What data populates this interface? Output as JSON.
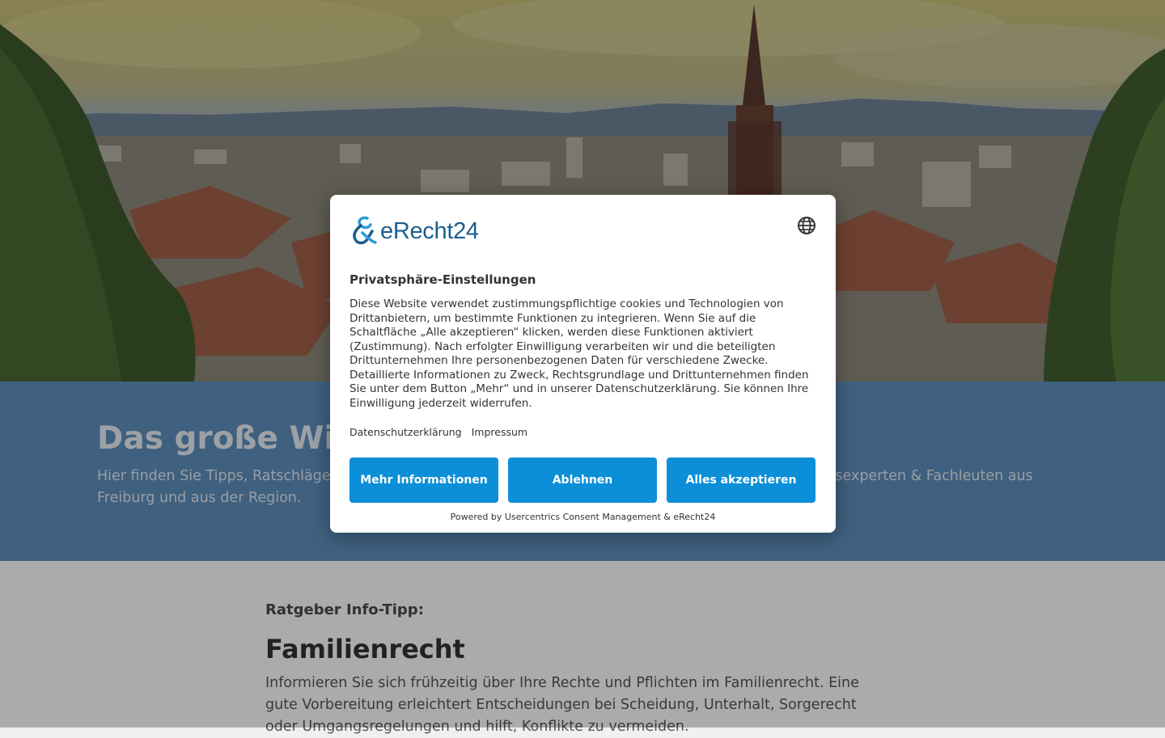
{
  "page": {
    "hero_image": "Freiburg city panorama with Freiburg Minster cathedral spire",
    "headline": "Das große Wissensportal für Recht & Rat",
    "intro": "Hier finden Sie Tipps, Ratschläge und Wissenswertes rund um Recht und Gesetz – aufbereitet von Rechtsexperten & Fachleuten aus Freiburg und aus der Region.",
    "tip_label": "Ratgeber Info-Tipp:",
    "tip_title": "Familienrecht",
    "tip_text": "Informieren Sie sich frühzeitig über Ihre Rechte und Pflichten im Familienrecht. Eine gute Vorbereitung erleichtert Entscheidungen bei Scheidung, Unterhalt, Sorgerecht oder Umgangsregelungen und hilft, Konflikte zu vermeiden."
  },
  "consent": {
    "logo_text": "eRecht24",
    "language_icon": "globe-icon",
    "title": "Privatsphäre-Einstellungen",
    "body": "Diese Website verwendet zustimmungspflichtige cookies und Technologien von Drittanbietern, um bestimmte Funktionen zu integrieren. Wenn Sie auf die Schaltfläche „Alle akzeptieren“ klicken, werden diese Funktionen aktiviert (Zustimmung). Nach erfolgter Einwilligung verarbeiten wir und die beteiligten Drittunternehmen Ihre personenbezogenen Daten für verschiedene Zwecke. Detaillierte Informationen zu Zweck, Rechtsgrundlage und Drittunternehmen finden Sie unter dem Button „Mehr“ und in unserer Datenschutzerklärung. Sie können Ihre Einwilligung jederzeit widerrufen.",
    "link_privacy": "Datenschutzerklärung",
    "link_imprint": "Impressum",
    "btn_more": "Mehr Informationen",
    "btn_deny": "Ablehnen",
    "btn_accept": "Alles akzeptieren",
    "powered_by": "Powered by Usercentrics Consent Management & eRecht24"
  },
  "colors": {
    "band": "#5f90be",
    "button": "#0b8fd8",
    "logo": "#1b5e8d"
  }
}
